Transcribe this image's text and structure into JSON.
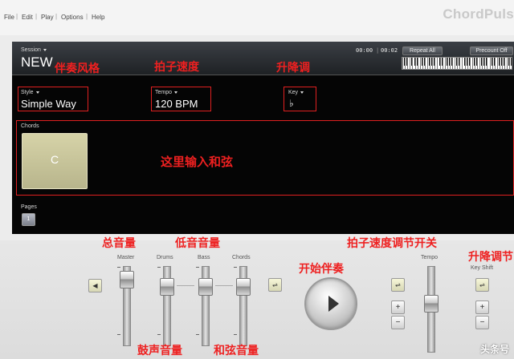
{
  "menu": {
    "items": [
      {
        "label": "File"
      },
      {
        "label": "Edit"
      },
      {
        "label": "Play"
      },
      {
        "label": "Options"
      },
      {
        "label": "Help"
      }
    ],
    "separator": "|",
    "logo": "ChordPuls"
  },
  "session": {
    "label": "Session",
    "value": "NEW",
    "time_current": "00:00",
    "time_total": "00:02",
    "repeat_label": "Repeat All",
    "precount_label": "Precount Off"
  },
  "style": {
    "label": "Style",
    "value": "Simple Way"
  },
  "tempo": {
    "label": "Tempo",
    "value": "120 BPM"
  },
  "key": {
    "label": "Key",
    "value": "♭"
  },
  "chords": {
    "label": "Chords",
    "items": [
      {
        "name": "C"
      }
    ]
  },
  "pages": {
    "label": "Pages",
    "current": "1"
  },
  "mixer": {
    "master": "Master",
    "drums": "Drums",
    "bass": "Bass",
    "chords": "Chords",
    "tempo": "Tempo",
    "key_shift": "Key Shift",
    "plus": "+",
    "minus": "−"
  },
  "annotations": {
    "style": "伴奏风格",
    "tempo": "拍子速度",
    "key": "升降调",
    "chord_input": "这里输入和弦",
    "master": "总音量",
    "bass": "低音音量",
    "tempo_switch": "拍子速度调节开关",
    "play": "开始伴奏",
    "key_shift": "升降调节",
    "drums": "鼓声音量",
    "chords": "和弦音量"
  },
  "watermark": "头条号",
  "colors": {
    "annotation": "#ee2020",
    "panel": "#050505",
    "chord_card": "#c8c5a0"
  }
}
